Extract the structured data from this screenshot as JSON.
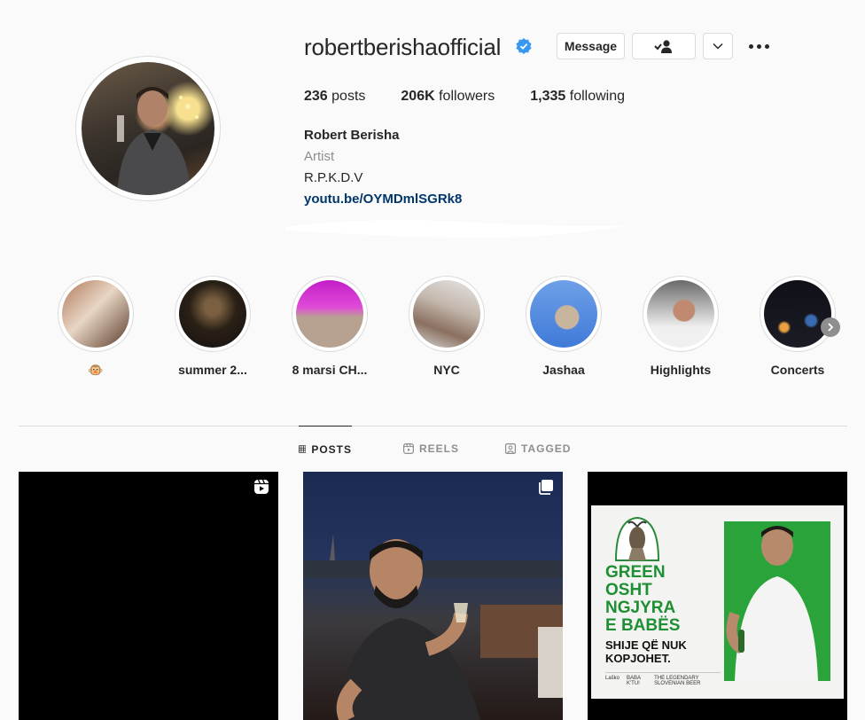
{
  "profile": {
    "username": "robertberishaofficial",
    "verified": true,
    "buttons": {
      "message": "Message"
    },
    "stats": {
      "posts_value": "236",
      "posts_label": "posts",
      "followers_value": "206K",
      "followers_label": "followers",
      "following_value": "1,335",
      "following_label": "following"
    },
    "full_name": "Robert Berisha",
    "category": "Artist",
    "bio": "R.P.K.D.V",
    "link": "youtu.be/OYMDmlSGRk8"
  },
  "highlights": [
    {
      "label": "🐵",
      "icon": "monkey-emoji"
    },
    {
      "label": "summer 2..."
    },
    {
      "label": "8 marsi CH..."
    },
    {
      "label": "NYC"
    },
    {
      "label": "Jashaa"
    },
    {
      "label": "Highlights"
    },
    {
      "label": "Concerts"
    }
  ],
  "tabs": [
    {
      "label": "POSTS",
      "active": true,
      "icon": "grid-icon"
    },
    {
      "label": "REELS",
      "active": false,
      "icon": "reels-icon"
    },
    {
      "label": "TAGGED",
      "active": false,
      "icon": "tagged-icon"
    }
  ],
  "posts": [
    {
      "type": "reel",
      "icon": "reel-icon"
    },
    {
      "type": "carousel",
      "icon": "carousel-icon"
    },
    {
      "type": "image",
      "ad": {
        "headline": [
          "GREEN",
          "OSHT",
          "NGJYRA",
          "E BABËS"
        ],
        "subline": [
          "SHIJE QË NUK",
          "KOPJOHET."
        ],
        "footer_left": "Laško",
        "footer_mid": "BABA K'TU!",
        "footer_right": "THE LEGENDARY SLOVENIAN BEER"
      }
    }
  ],
  "colors": {
    "link": "#00376b",
    "verified": "#3897f0",
    "text": "#262626",
    "muted": "#8e8e8e",
    "border": "#dbdbdb",
    "ad_green": "#1e8f33"
  }
}
